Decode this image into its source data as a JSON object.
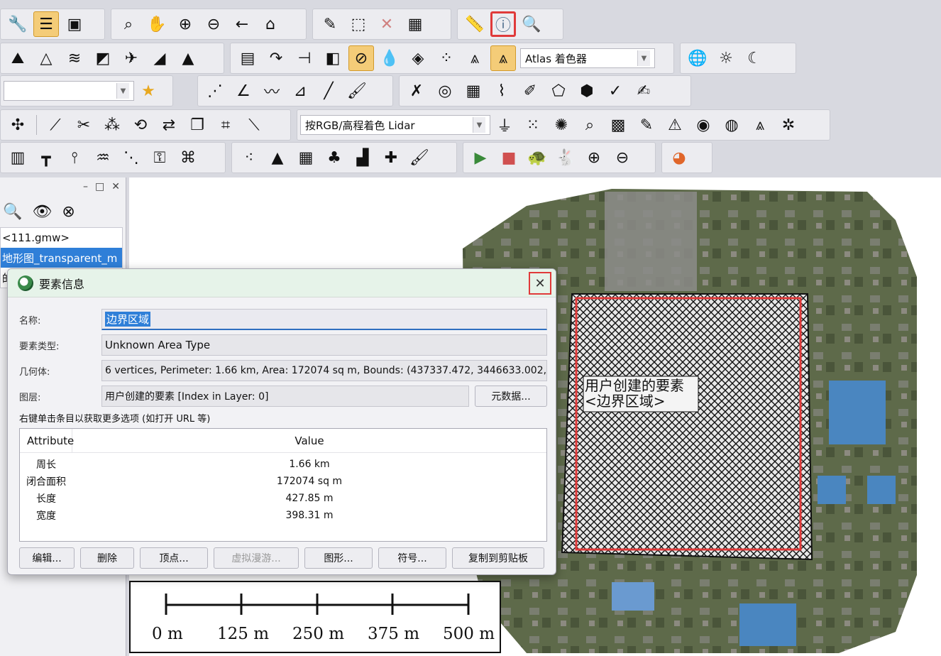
{
  "toolbar": {
    "row1_icons": [
      "wrench-icon",
      "layers-icon",
      "window-icon",
      "zoom-box-icon",
      "pan-hand-icon",
      "zoom-in-icon",
      "zoom-out-icon",
      "back-arrow-icon",
      "home-icon",
      "pencil-icon",
      "select-dashed-icon",
      "delete-x-icon",
      "grid-select-icon",
      "ruler-icon",
      "info-icon",
      "find-icon"
    ],
    "row2_icons": [
      "flag-terrain-icon",
      "terrain-icon",
      "contour-icon",
      "map-color-icon",
      "satellite-icon",
      "slope-icon",
      "hill-icon",
      "table-icon",
      "arrow-curve-icon",
      "measure-icon",
      "3d-cube-icon",
      "grid-slope-icon",
      "water-drop-icon",
      "water-drop2-icon",
      "spray-icon",
      "mountain-icon",
      "mountain-active-icon"
    ],
    "shader_select": "Atlas 着色器",
    "row2b_icons": [
      "globe-icon",
      "sun-icon",
      "moon-icon"
    ],
    "row3_icons": [
      "star-icon",
      "digitize-icon",
      "curve-edit-icon",
      "polyline-icon",
      "area-edit-icon",
      "line-tool-icon",
      "brush-icon",
      "coord-icon",
      "target-icon",
      "grid-edit-icon",
      "vertex-icon",
      "feature-edit-icon",
      "polygon-paint-icon",
      "merge-icon",
      "check-icon",
      "edit-doc-icon"
    ],
    "row4_icons": [
      "vertex-add-icon",
      "line-split-icon",
      "cut-icon",
      "node-icon",
      "rotate-icon",
      "move-icon",
      "copy-icon",
      "crop-icon",
      "ruler-diag-icon"
    ],
    "lidar_select": "按RGB/高程着色 Lidar",
    "row4b_icons": [
      "filter-icon",
      "point-cloud-icon",
      "classify-icon",
      "search-points-icon",
      "grid-points-icon",
      "edit-points-icon",
      "triangle-icon",
      "color-points-icon",
      "sphere-points-icon",
      "tree-points-icon",
      "network-icon"
    ],
    "row5_icons": [
      "building-icon",
      "tower-icon",
      "powerline-icon",
      "water-icon",
      "dots-icon",
      "key-icon",
      "mesh-icon",
      "scatter-icon",
      "mountain-dark-icon",
      "building-detect-icon",
      "tree-icon",
      "chart-icon",
      "puzzle-icon",
      "paint-icon",
      "play-icon",
      "stop-icon",
      "turtle-icon",
      "rabbit-icon",
      "add-layer-icon",
      "remove-layer-icon",
      "pie-icon"
    ]
  },
  "left_panel": {
    "header_close": "✕",
    "header_max": "□",
    "header_min": "–",
    "items": [
      "<111.gmw>",
      "地形图_transparent_m",
      "的"
    ]
  },
  "dialog": {
    "title": "要素信息",
    "name_label": "名称:",
    "name_value": "边界区域",
    "type_label": "要素类型:",
    "type_value": "Unknown Area Type",
    "geom_label": "几何体:",
    "geom_value": "6 vertices, Perimeter: 1.66 km, Area: 172074 sq m, Bounds: (437337.472, 3446633.002, 43775",
    "layer_label": "图层:",
    "layer_value": "用户创建的要素 [Index in Layer: 0]",
    "metadata_button": "元数据...",
    "hint": "右键单击条目以获取更多选项 (如打开 URL 等)",
    "table_headers": [
      "Attribute",
      "Value"
    ],
    "rows": [
      {
        "attr": "周长",
        "value": "1.66 km"
      },
      {
        "attr": "闭合面积",
        "value": "172074 sq m"
      },
      {
        "attr": "长度",
        "value": "427.85 m"
      },
      {
        "attr": "宽度",
        "value": "398.31 m"
      }
    ],
    "buttons": [
      "编辑...",
      "删除",
      "顶点...",
      "虚拟漫游...",
      "图形...",
      "符号...",
      "复制到剪贴板"
    ]
  },
  "map": {
    "feature_label_line1": "用户创建的要素",
    "feature_label_line2": "<边界区域>"
  },
  "scalebar": {
    "labels": [
      "0 m",
      "125 m",
      "250 m",
      "375 m",
      "500 m"
    ]
  },
  "colors": {
    "highlight_red": "#e03a3a",
    "selection_blue": "#2f7fd8",
    "dialog_title_bg": "#e6f3e9"
  }
}
